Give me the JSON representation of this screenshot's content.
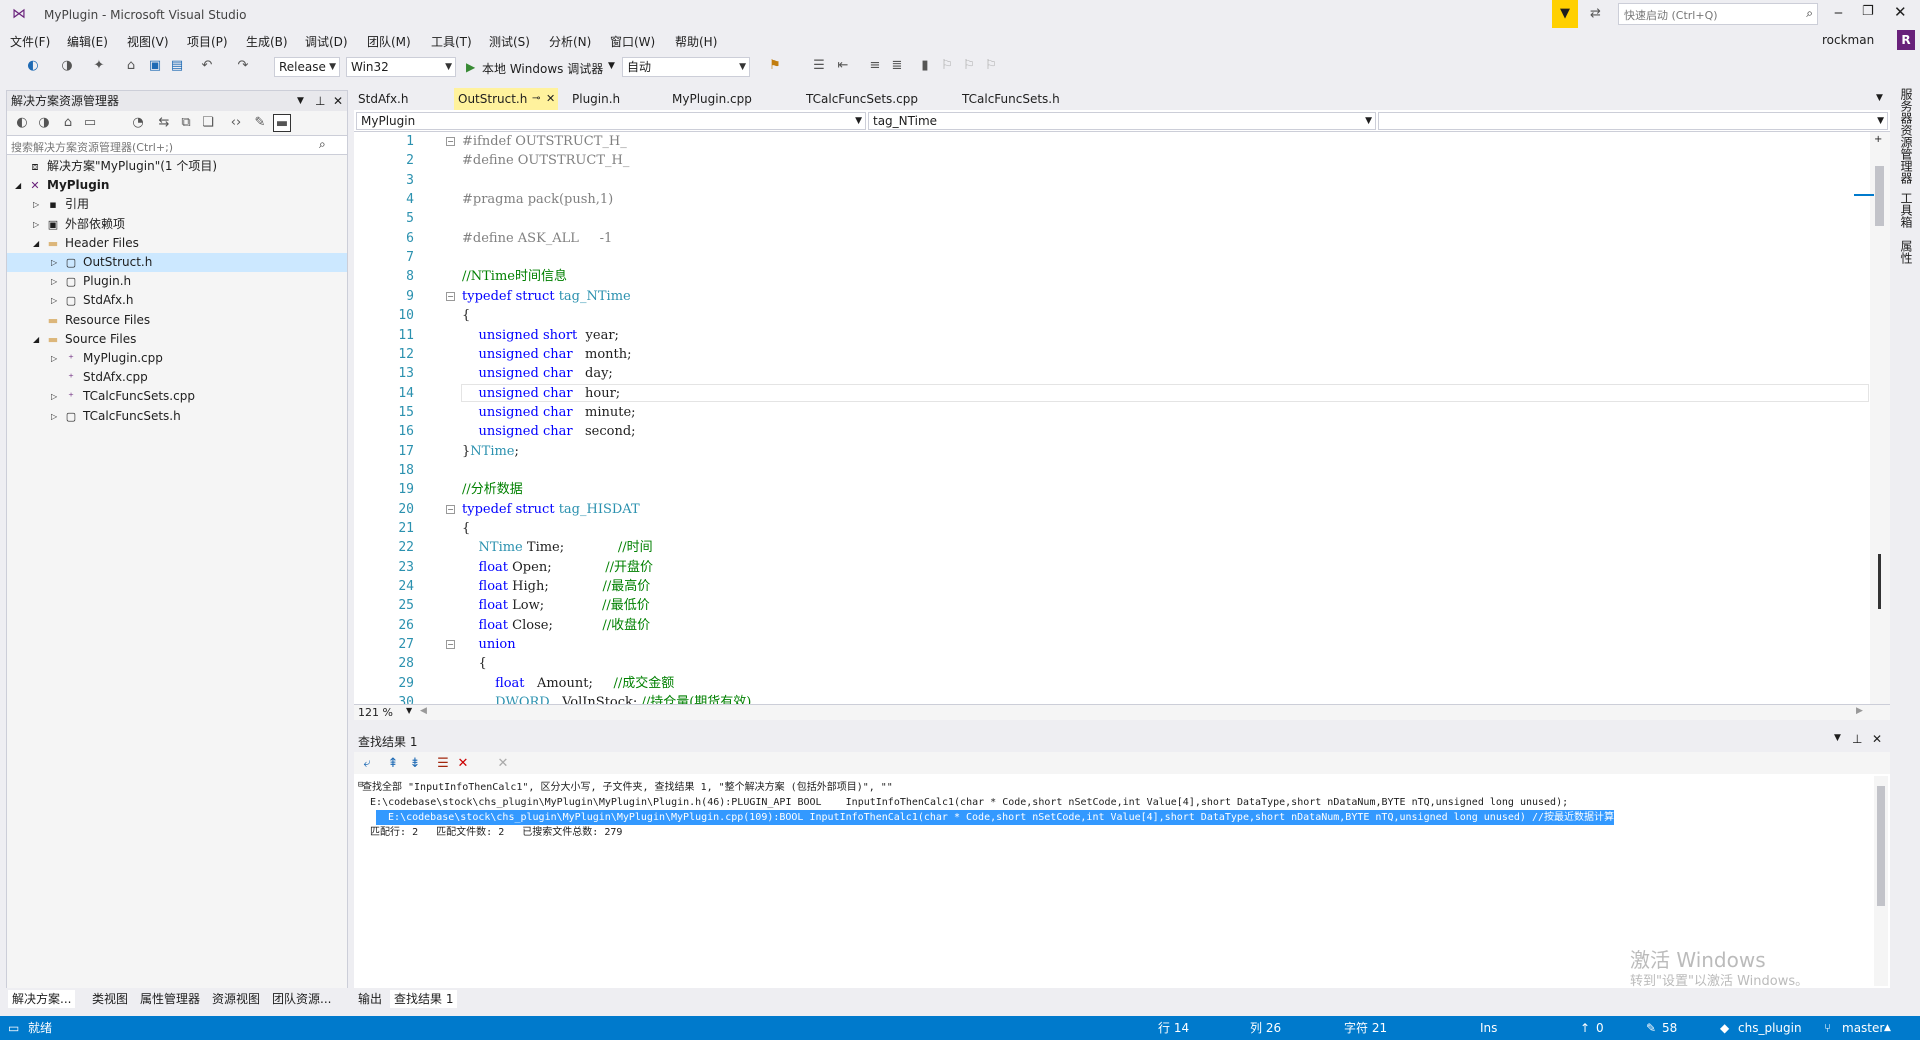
{
  "window": {
    "title": "MyPlugin - Microsoft Visual Studio",
    "quick_launch_placeholder": "快速启动 (Ctrl+Q)",
    "user": "rockman",
    "user_initial": "R"
  },
  "menu": [
    "文件(F)",
    "编辑(E)",
    "视图(V)",
    "项目(P)",
    "生成(B)",
    "调试(D)",
    "团队(M)",
    "工具(T)",
    "测试(S)",
    "分析(N)",
    "窗口(W)",
    "帮助(H)"
  ],
  "toolbar": {
    "config": "Release",
    "platform": "Win32",
    "debugger": "本地 Windows 调试器",
    "mode": "自动"
  },
  "solution_explorer": {
    "title": "解决方案资源管理器",
    "search_placeholder": "搜索解决方案资源管理器(Ctrl+;)",
    "items": [
      {
        "label": "解决方案\"MyPlugin\"(1 个项目)",
        "level": 0,
        "expander": "",
        "icon": "solution-icon"
      },
      {
        "label": "MyPlugin",
        "level": 0,
        "expander": "◢",
        "icon": "project-icon",
        "bold": true
      },
      {
        "label": "引用",
        "level": 1,
        "expander": "▷",
        "icon": "references-icon"
      },
      {
        "label": "外部依赖项",
        "level": 1,
        "expander": "▷",
        "icon": "external-deps-icon"
      },
      {
        "label": "Header Files",
        "level": 1,
        "expander": "◢",
        "icon": "folder-icon"
      },
      {
        "label": "OutStruct.h",
        "level": 2,
        "expander": "▷",
        "icon": "header-file-icon",
        "selected": true
      },
      {
        "label": "Plugin.h",
        "level": 2,
        "expander": "▷",
        "icon": "header-file-icon"
      },
      {
        "label": "StdAfx.h",
        "level": 2,
        "expander": "▷",
        "icon": "header-file-icon"
      },
      {
        "label": "Resource Files",
        "level": 1,
        "expander": "",
        "icon": "folder-icon"
      },
      {
        "label": "Source Files",
        "level": 1,
        "expander": "◢",
        "icon": "folder-icon"
      },
      {
        "label": "MyPlugin.cpp",
        "level": 2,
        "expander": "▷",
        "icon": "cpp-file-icon"
      },
      {
        "label": "StdAfx.cpp",
        "level": 2,
        "expander": "",
        "icon": "cpp-file-icon"
      },
      {
        "label": "TCalcFuncSets.cpp",
        "level": 2,
        "expander": "▷",
        "icon": "cpp-file-icon"
      },
      {
        "label": "TCalcFuncSets.h",
        "level": 2,
        "expander": "▷",
        "icon": "header-file-icon"
      }
    ]
  },
  "editor_tabs": [
    "StdAfx.h",
    "OutStruct.h",
    "Plugin.h",
    "MyPlugin.cpp",
    "TCalcFuncSets.cpp",
    "TCalcFuncSets.h"
  ],
  "active_tab": "OutStruct.h",
  "nav": {
    "scope": "MyPlugin",
    "member": "tag_NTime"
  },
  "zoom": "121 %",
  "code": [
    {
      "n": "1",
      "t": "#ifndef OUTSTRUCT_H_"
    },
    {
      "n": "2",
      "t": "#define OUTSTRUCT_H_"
    },
    {
      "n": "3",
      "t": ""
    },
    {
      "n": "4",
      "t": "#pragma pack(push,1)"
    },
    {
      "n": "5",
      "t": ""
    },
    {
      "n": "6",
      "t": "#define ASK_ALL     -1"
    },
    {
      "n": "7",
      "t": ""
    },
    {
      "n": "8",
      "t": "//NTime时间信息"
    },
    {
      "n": "9",
      "t": "typedef struct tag_NTime"
    },
    {
      "n": "10",
      "t": "{"
    },
    {
      "n": "11",
      "t": "    unsigned short  year;"
    },
    {
      "n": "12",
      "t": "    unsigned char   month;"
    },
    {
      "n": "13",
      "t": "    unsigned char   day;"
    },
    {
      "n": "14",
      "t": "    unsigned char   hour;"
    },
    {
      "n": "15",
      "t": "    unsigned char   minute;"
    },
    {
      "n": "16",
      "t": "    unsigned char   second;"
    },
    {
      "n": "17",
      "t": "}NTime;"
    },
    {
      "n": "18",
      "t": ""
    },
    {
      "n": "19",
      "t": "//分析数据"
    },
    {
      "n": "20",
      "t": "typedef struct tag_HISDAT"
    },
    {
      "n": "21",
      "t": "{"
    },
    {
      "n": "22",
      "t": "    NTime Time;             //时间"
    },
    {
      "n": "23",
      "t": "    float Open;             //开盘价"
    },
    {
      "n": "24",
      "t": "    float High;             //最高价"
    },
    {
      "n": "25",
      "t": "    float Low;              //最低价"
    },
    {
      "n": "26",
      "t": "    float Close;            //收盘价"
    },
    {
      "n": "27",
      "t": "    union"
    },
    {
      "n": "28",
      "t": "    {"
    },
    {
      "n": "29",
      "t": "        float   Amount;     //成交金额"
    },
    {
      "n": "30",
      "t": "        DWORD   VolInStock; //持仓量(期货有效)"
    }
  ],
  "find_results": {
    "title": "查找结果 1",
    "lines": [
      "查找全部 \"InputInfoThenCalc1\", 区分大小写, 子文件夹, 查找结果 1, \"整个解决方案 (包括外部项目)\", \"\"",
      "  E:\\codebase\\stock\\chs_plugin\\MyPlugin\\MyPlugin\\Plugin.h(46):PLUGIN_API BOOL    InputInfoThenCalc1(char * Code,short nSetCode,int Value[4],short DataType,short nDataNum,BYTE nTQ,unsigned long unused);",
      "  E:\\codebase\\stock\\chs_plugin\\MyPlugin\\MyPlugin\\MyPlugin.cpp(109):BOOL InputInfoThenCalc1(char * Code,short nSetCode,int Value[4],short DataType,short nDataNum,BYTE nTQ,unsigned long unused) //按最近数据计算",
      "  匹配行: 2   匹配文件数: 2   已搜索文件总数: 279"
    ],
    "selected_line": 2
  },
  "bottom_tabs_left": [
    "解决方案...",
    "类视图",
    "属性管理器",
    "资源视图",
    "团队资源..."
  ],
  "bottom_tabs_center": [
    "输出",
    "查找结果 1"
  ],
  "right_strip": [
    "服务器资源管理器",
    "工具箱",
    "属性"
  ],
  "watermark": {
    "line1": "激活 Windows",
    "line2": "转到\"设置\"以激活 Windows。"
  },
  "status": {
    "ready": "就绪",
    "line": "行 14",
    "col": "列 26",
    "char": "字符 21",
    "ins": "Ins",
    "up": "0",
    "edits": "58",
    "repo": "chs_plugin",
    "branch": "master"
  },
  "colors": {
    "accent": "#007acc",
    "tab_active": "#fff29d",
    "selection": "#3399ff"
  }
}
